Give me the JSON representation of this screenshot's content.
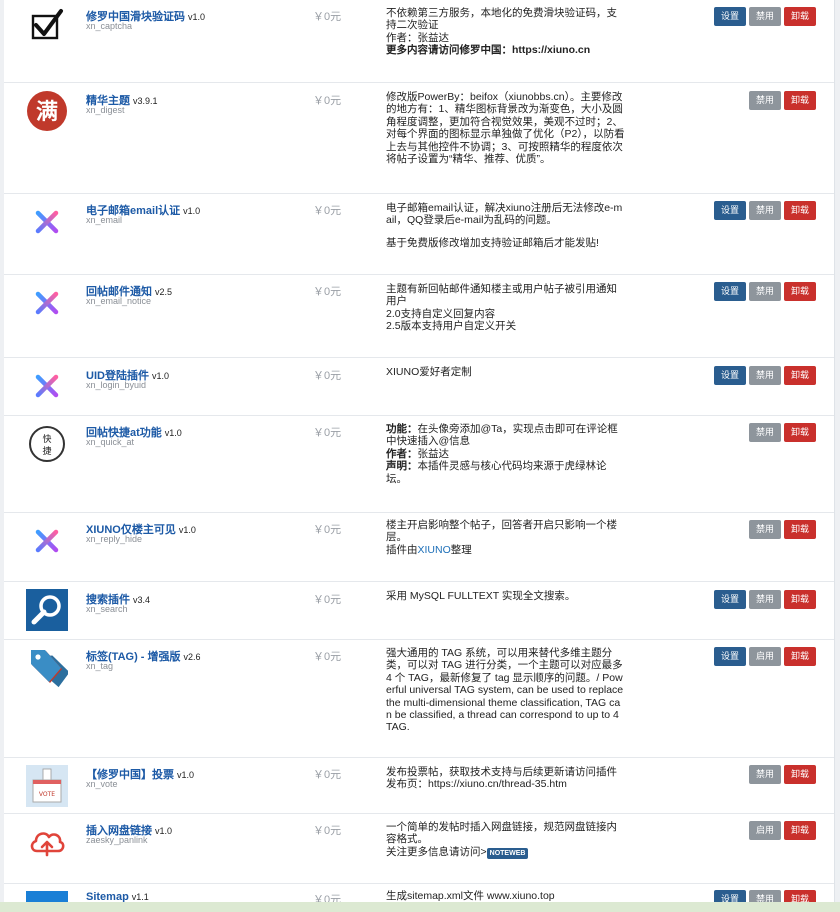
{
  "buttons": {
    "settings": "设置",
    "disable": "禁用",
    "enable": "启用",
    "uninstall": "卸载"
  },
  "plugins": [
    {
      "name": "修罗中国滑块验证码",
      "version": "v1.0",
      "id": "xn_captcha",
      "price": "￥0元",
      "icon": "checkmark-icon",
      "desc_html": "<p>不依赖第三方服务，本地化的免费滑块验证码，支持二次验证</p><p>作者：张益达</p><p><b>更多内容请访问修罗中国：https://xiuno.cn</b></p>",
      "buttons": [
        "settings",
        "disable",
        "uninstall"
      ]
    },
    {
      "name": "精华主题",
      "version": "v3.9.1",
      "id": "xn_digest",
      "price": "￥0元",
      "icon": "full-badge-icon",
      "desc_html": "<p>修改版PowerBy：beifox（xiunobbs.cn）。主要修改的地方有：1、精华图标背景改为渐变色，大小及圆角程度调整，更加符合视觉效果，美观不过时；2、对每个界面的图标显示单独做了优化（P2），以防看上去与其他控件不协调；3、可按照精华的程度依次将帖子设置为“精华、推荐、优质”。</p>",
      "buttons": [
        "disable",
        "uninstall"
      ]
    },
    {
      "name": "电子邮箱email认证",
      "version": "v1.0",
      "id": "xn_email",
      "price": "￥0元",
      "icon": "x-logo-icon",
      "desc_html": "<p>电子邮箱email认证，解决xiuno注册后无法修改e-mail，QQ登录后e-mail为乱码的问题。</p><p class=\"gap\">基于免费版修改增加支持验证邮箱后才能发贴!</p>",
      "buttons": [
        "settings",
        "disable",
        "uninstall"
      ]
    },
    {
      "name": "回帖邮件通知",
      "version": "v2.5",
      "id": "xn_email_notice",
      "price": "￥0元",
      "icon": "x-logo-icon",
      "desc_html": "<p>主题有新回帖邮件通知楼主或用户帖子被引用通知用户</p><p>2.0支持自定义回复内容</p><p>2.5版本支持用户自定义开关</p>",
      "buttons": [
        "settings",
        "disable",
        "uninstall"
      ]
    },
    {
      "name": "UID登陆插件",
      "version": "v1.0",
      "id": "xn_login_byuid",
      "price": "￥0元",
      "icon": "x-logo-icon",
      "desc_html": "<p>XIUNO爱好者定制</p>",
      "buttons": [
        "settings",
        "disable",
        "uninstall"
      ]
    },
    {
      "name": "回帖快捷at功能",
      "version": "v1.0",
      "id": "xn_quick_at",
      "price": "￥0元",
      "icon": "quick-at-seal-icon",
      "desc_html": "<p><b>功能：</b>在头像旁添加@Ta，实现点击即可在评论框中快速插入@信息</p><p><b>作者：</b>张益达</p><p><b>声明：</b>本插件灵感与核心代码均来源于虎绿林论坛。</p>",
      "buttons": [
        "disable",
        "uninstall"
      ]
    },
    {
      "name": "XIUNO仅楼主可见",
      "version": "v1.0",
      "id": "xn_reply_hide",
      "price": "￥0元",
      "icon": "x-logo-icon",
      "desc_html": "<p>楼主开启影响整个帖子，回答者开启只影响一个楼层。</p><p>插件由<span class=\"link\">XIUNO</span>整理</p>",
      "buttons": [
        "disable",
        "uninstall"
      ]
    },
    {
      "name": "搜索插件",
      "version": "v3.4",
      "id": "xn_search",
      "price": "￥0元",
      "icon": "search-icon",
      "desc_html": "<p>采用 MySQL FULLTEXT 实现全文搜索。</p>",
      "buttons": [
        "settings",
        "disable",
        "uninstall"
      ]
    },
    {
      "name": "标签(TAG) - 增强版",
      "version": "v2.6",
      "id": "xn_tag",
      "price": "￥0元",
      "icon": "tag-icon",
      "desc_html": "<p>强大通用的 TAG 系统，可以用来替代多维主题分类，可以对 TAG 进行分类，一个主题可以对应最多 4 个 TAG，最新修复了 tag 显示顺序的问题。/ Powerful universal TAG system, can be used to replace the multi-dimensional theme classification, TAG can be classified, a thread can correspond to up to 4 TAG.</p>",
      "buttons": [
        "settings",
        "enable",
        "uninstall"
      ]
    },
    {
      "name": "【修罗中国】投票",
      "version": "v1.0",
      "id": "xn_vote",
      "price": "￥0元",
      "icon": "ballot-box-icon",
      "desc_html": "<p>发布投票帖，获取技术支持与后续更新请访问插件发布页：https://xiuno.cn/thread-35.htm</p>",
      "buttons": [
        "disable",
        "uninstall"
      ]
    },
    {
      "name": "插入网盘链接",
      "version": "v1.0",
      "id": "zaesky_panlink",
      "price": "￥0元",
      "icon": "cloud-upload-icon",
      "desc_html": "<p>一个简单的发帖时插入网盘链接，规范网盘链接内容格式。</p><p>关注更多信息请访问&gt;<span class=\"tag-noteweb\">NOTEWEB</span></p>",
      "buttons": [
        "enable",
        "uninstall"
      ]
    },
    {
      "name": "Sitemap",
      "version": "v1.1",
      "id": "",
      "price": "￥0元",
      "icon": "sitemap-icon",
      "desc_html": "<p>生成sitemap.xml文件 www.xiuno.top</p>",
      "buttons": [
        "settings",
        "disable",
        "uninstall"
      ]
    }
  ]
}
